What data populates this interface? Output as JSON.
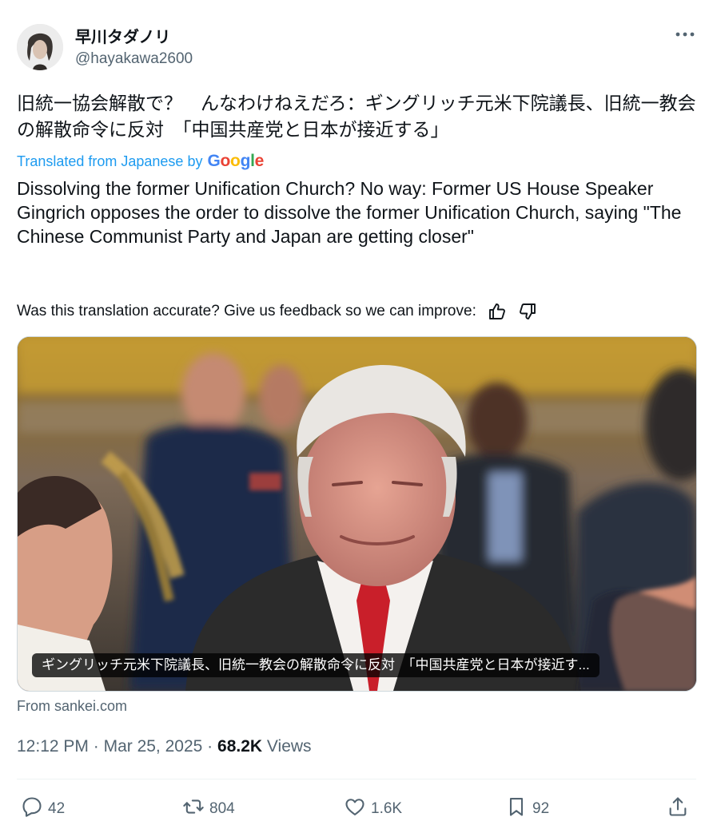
{
  "author": {
    "display_name": "早川タダノリ",
    "handle": "@hayakawa2600"
  },
  "post": {
    "original_text": "旧統一協会解散で？　んなわけねえだろ：ギングリッチ元米下院議長、旧統一教会の解散命令に反対　「中国共産党と日本が接近する」",
    "translated_from_label": "Translated from Japanese by",
    "google_logo_text": "Google",
    "translation": "Dissolving the former Unification Church? No way: Former US House Speaker Gingrich opposes the order to dissolve the former Unification Church, saying \"The Chinese Communist Party and Japan are getting closer\"",
    "feedback_prompt": "Was this translation accurate? Give us feedback so we can improve:"
  },
  "media": {
    "caption": "ギングリッチ元米下院議長、旧統一教会の解散命令に反対　「中国共産党と日本が接近す...",
    "source": "From sankei.com"
  },
  "meta": {
    "time": "12:12 PM",
    "separator": "·",
    "date": "Mar 25, 2025",
    "views_count": "68.2K",
    "views_label": "Views"
  },
  "actions": {
    "replies": "42",
    "reposts": "804",
    "likes": "1.6K",
    "bookmarks": "92"
  },
  "icons": [
    "more-icon",
    "thumbs-up-icon",
    "thumbs-down-icon",
    "reply-icon",
    "repost-icon",
    "like-icon",
    "bookmark-icon",
    "share-icon"
  ],
  "colors": {
    "link_blue": "#1d9bf0",
    "secondary_text": "#536471",
    "primary_text": "#0f1419",
    "google_blue": "#4285f4",
    "google_red": "#ea4335",
    "google_yellow": "#fbbc05",
    "google_green": "#34a853"
  }
}
